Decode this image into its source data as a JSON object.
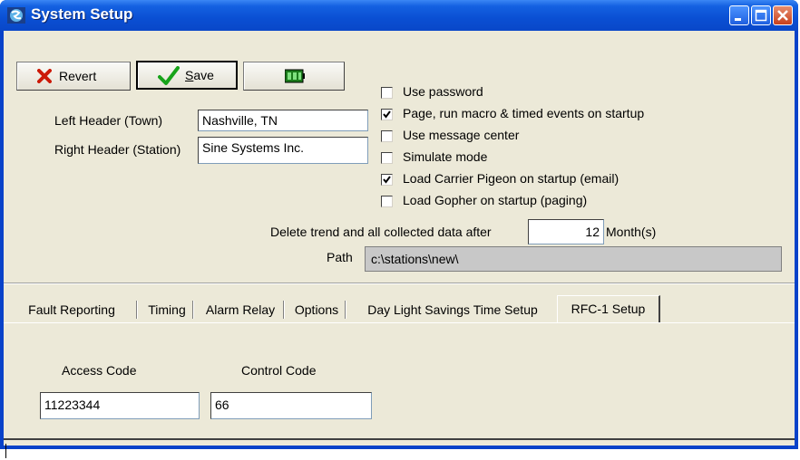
{
  "window": {
    "title": "System Setup",
    "controls": [
      "minimize-icon",
      "maximize-icon",
      "close-icon"
    ]
  },
  "toolbar": {
    "revert_label": "Revert",
    "save_label": "Save",
    "save_access_key": "S",
    "save_rest": "ave",
    "revert_icon": "red-x-icon",
    "save_icon": "green-checkmark-icon",
    "third_icon": "green-battery-icon"
  },
  "headers": {
    "left_label": "Left Header (Town)",
    "left_value": "Nashville, TN",
    "right_label": "Right Header (Station)",
    "right_value": "Sine Systems Inc."
  },
  "options": [
    {
      "label": "Use password",
      "checked": false
    },
    {
      "label": "Page, run macro & timed events on startup",
      "checked": true
    },
    {
      "label": "Use message center",
      "checked": false
    },
    {
      "label": "Simulate mode",
      "checked": false
    },
    {
      "label": "Load Carrier Pigeon on startup (email)",
      "checked": true
    },
    {
      "label": "Load Gopher on startup (paging)",
      "checked": false
    }
  ],
  "retention": {
    "label": "Delete trend and all collected data after",
    "value": "12",
    "unit": "Month(s)"
  },
  "path": {
    "label": "Path",
    "value": "c:\\stations\\new\\"
  },
  "tabs": [
    {
      "label": "Fault Reporting",
      "active": false
    },
    {
      "label": "Timing",
      "active": false
    },
    {
      "label": "Alarm Relay",
      "active": false
    },
    {
      "label": "Options",
      "active": false
    },
    {
      "label": "Day Light Savings Time Setup",
      "active": false
    },
    {
      "label": "RFC-1 Setup",
      "active": true
    }
  ],
  "rfc": {
    "access_label": "Access Code",
    "access_value": "11223344",
    "control_label": "Control Code",
    "control_value": "66"
  },
  "colors": {
    "titlebar": "#0a4fd3",
    "face": "#ece9d8",
    "path_field": "#c8c8c8",
    "close_button": "#c7401d"
  }
}
